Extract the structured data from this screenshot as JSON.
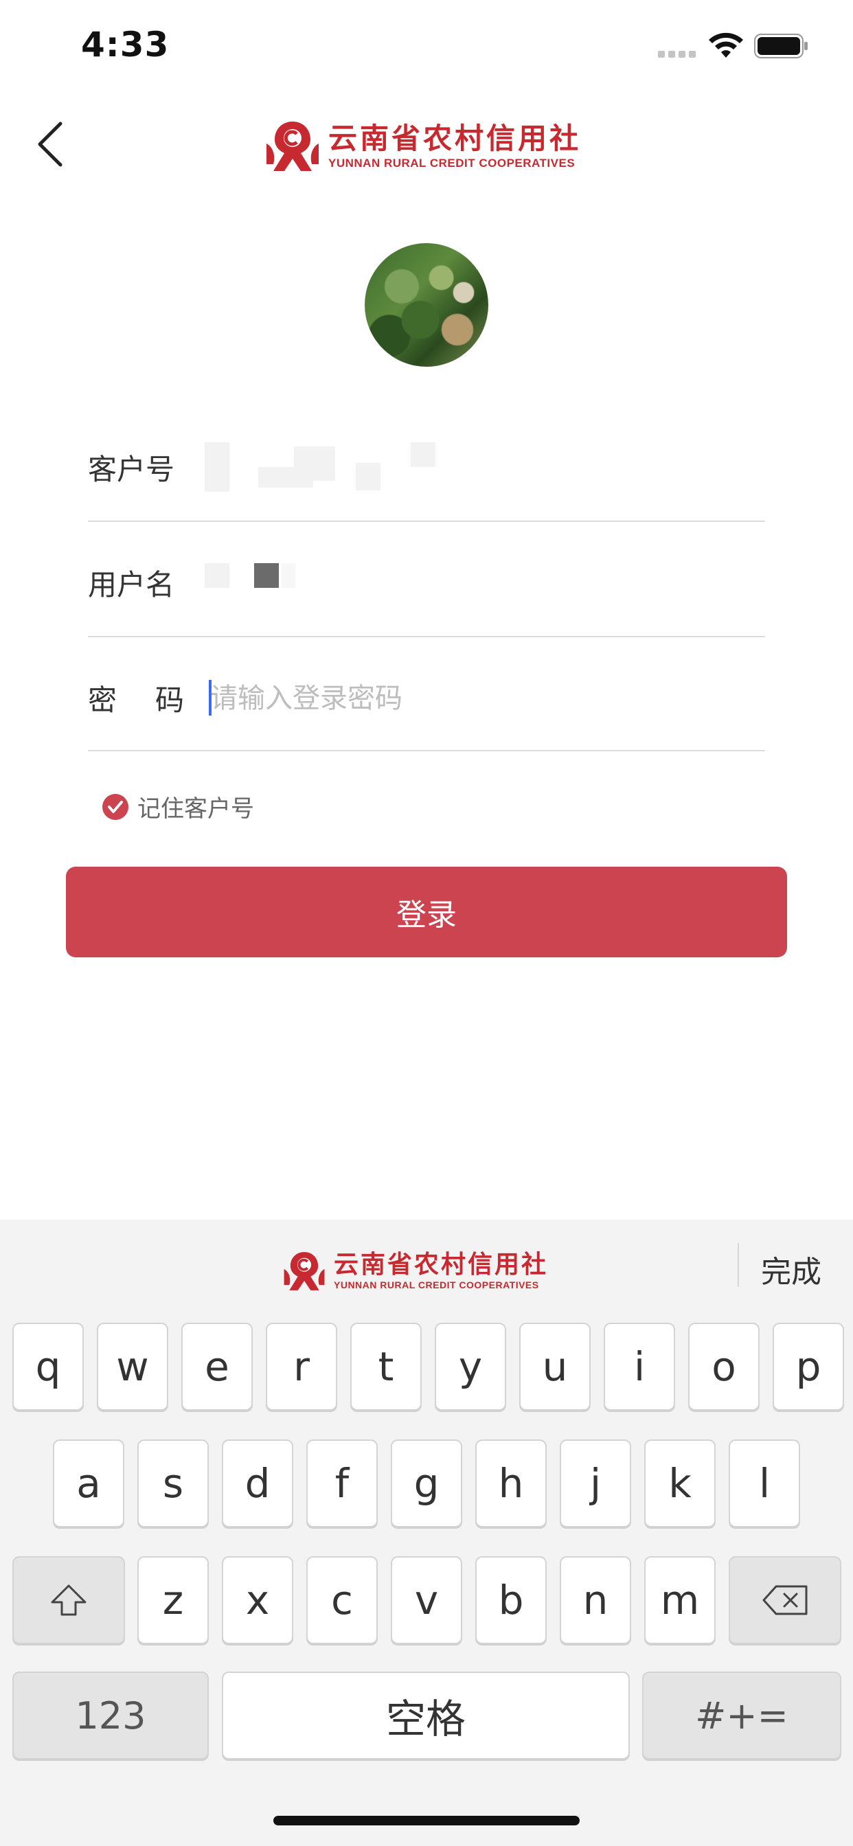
{
  "status_bar": {
    "time": "4:33"
  },
  "header": {
    "brand_cn": "云南省农村信用社",
    "brand_en": "YUNNAN RURAL CREDIT COOPERATIVES"
  },
  "form": {
    "customer_label": "客户号",
    "user_label": "用户名",
    "password_label_1": "密",
    "password_label_2": "码",
    "password_placeholder": "请输入登录密码"
  },
  "remember": {
    "label": "记住客户号",
    "checked": true
  },
  "login_button": "登录",
  "keyboard": {
    "brand_cn": "云南省农村信用社",
    "brand_en": "YUNNAN RURAL CREDIT COOPERATIVES",
    "done": "完成",
    "row1": [
      "q",
      "w",
      "e",
      "r",
      "t",
      "y",
      "u",
      "i",
      "o",
      "p"
    ],
    "row2": [
      "a",
      "s",
      "d",
      "f",
      "g",
      "h",
      "j",
      "k",
      "l"
    ],
    "row3": [
      "z",
      "x",
      "c",
      "v",
      "b",
      "n",
      "m"
    ],
    "numbers_key": "123",
    "space_key": "空格",
    "symbols_key": "#+="
  },
  "colors": {
    "brand_red": "#c62a30",
    "button_red": "#cb444f"
  }
}
